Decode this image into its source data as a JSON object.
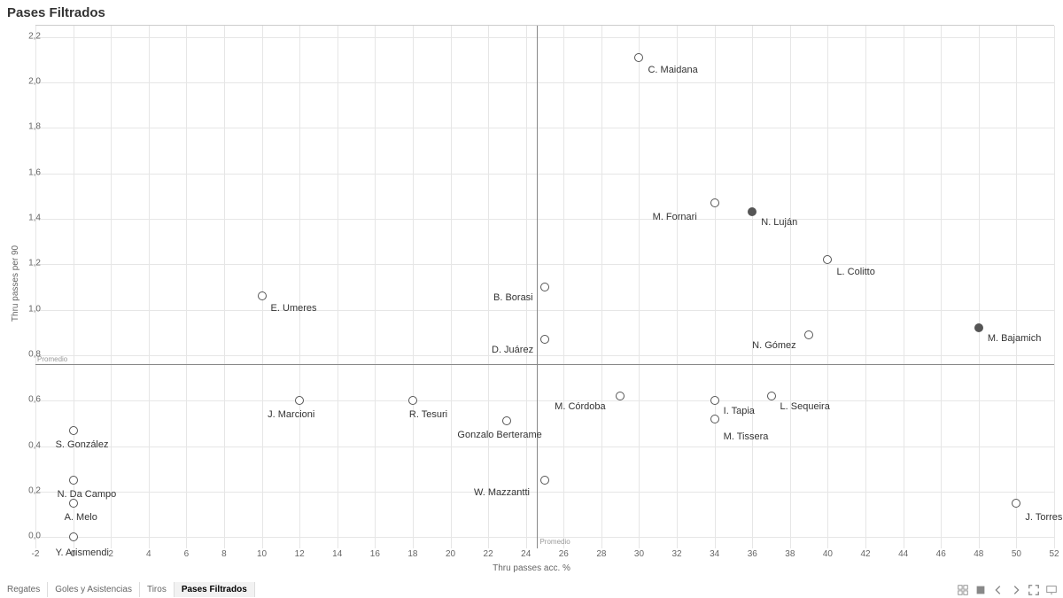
{
  "title": "Pases Filtrados",
  "axis": {
    "xlabel": "Thru passes acc. %",
    "ylabel": "Thru passes per 90"
  },
  "reference": {
    "label": "Promedio",
    "xval": 24.6,
    "yval": 0.76
  },
  "tabs": [
    "Regates",
    "Goles y Asistencias",
    "Tiros",
    "Pases Filtrados"
  ],
  "active_tab": 3,
  "chart_data": {
    "type": "scatter",
    "xlabel": "Thru passes acc. %",
    "ylabel": "Thru passes per 90",
    "xlim": [
      -2,
      52
    ],
    "ylim": [
      -0.05,
      2.25
    ],
    "xticks": [
      -2,
      0,
      2,
      4,
      6,
      8,
      10,
      12,
      14,
      16,
      18,
      20,
      22,
      24,
      26,
      28,
      30,
      32,
      34,
      36,
      38,
      40,
      42,
      44,
      46,
      48,
      50,
      52
    ],
    "yticks": [
      0.0,
      0.2,
      0.4,
      0.6,
      0.8,
      1.0,
      1.2,
      1.4,
      1.6,
      1.8,
      2.0,
      2.2
    ],
    "reference_lines": {
      "x": 24.6,
      "y": 0.76,
      "label": "Promedio"
    },
    "points": [
      {
        "name": "C. Maidana",
        "x": 30.0,
        "y": 2.11,
        "filled": false
      },
      {
        "name": "M. Fornari",
        "x": 34.0,
        "y": 1.47,
        "filled": false
      },
      {
        "name": "N. Luján",
        "x": 36.0,
        "y": 1.43,
        "filled": true
      },
      {
        "name": "L. Colitto",
        "x": 40.0,
        "y": 1.22,
        "filled": false
      },
      {
        "name": "B. Borasi",
        "x": 25.0,
        "y": 1.1,
        "filled": false
      },
      {
        "name": "E. Umeres",
        "x": 10.0,
        "y": 1.06,
        "filled": false
      },
      {
        "name": "M. Bajamich",
        "x": 48.0,
        "y": 0.92,
        "filled": true
      },
      {
        "name": "N. Gómez",
        "x": 39.0,
        "y": 0.89,
        "filled": false
      },
      {
        "name": "D. Juárez",
        "x": 25.0,
        "y": 0.87,
        "filled": false
      },
      {
        "name": "M. Córdoba",
        "x": 29.0,
        "y": 0.62,
        "filled": false
      },
      {
        "name": "L. Sequeira",
        "x": 37.0,
        "y": 0.62,
        "filled": false
      },
      {
        "name": "J. Marcioni",
        "x": 12.0,
        "y": 0.6,
        "filled": false
      },
      {
        "name": "R. Tesuri",
        "x": 18.0,
        "y": 0.6,
        "filled": false
      },
      {
        "name": "I. Tapia",
        "x": 34.0,
        "y": 0.6,
        "filled": false
      },
      {
        "name": "M. Tissera",
        "x": 34.0,
        "y": 0.52,
        "filled": false
      },
      {
        "name": "Gonzalo Berterame",
        "x": 23.0,
        "y": 0.51,
        "filled": false
      },
      {
        "name": "S. González",
        "x": 0.0,
        "y": 0.47,
        "filled": false
      },
      {
        "name": "W. Mazzantti",
        "x": 25.0,
        "y": 0.25,
        "filled": false
      },
      {
        "name": "N. Da Campo",
        "x": 0.0,
        "y": 0.25,
        "filled": false
      },
      {
        "name": "A. Melo",
        "x": 0.0,
        "y": 0.15,
        "filled": false
      },
      {
        "name": "J. Torres",
        "x": 50.0,
        "y": 0.15,
        "filled": false
      },
      {
        "name": "Y. Arismendi",
        "x": 0.0,
        "y": 0.0,
        "filled": false
      }
    ],
    "label_offsets": {
      "C. Maidana": {
        "dx": 10,
        "dy": 8
      },
      "M. Fornari": {
        "dx": -70,
        "dy": 10
      },
      "N. Luján": {
        "dx": 10,
        "dy": 6
      },
      "L. Colitto": {
        "dx": 10,
        "dy": 8
      },
      "B. Borasi": {
        "dx": -58,
        "dy": 6
      },
      "E. Umeres": {
        "dx": 10,
        "dy": 8
      },
      "M. Bajamich": {
        "dx": 10,
        "dy": 6
      },
      "N. Gómez": {
        "dx": -64,
        "dy": 6
      },
      "D. Juárez": {
        "dx": -60,
        "dy": 6
      },
      "M. Córdoba": {
        "dx": -74,
        "dy": 6
      },
      "L. Sequeira": {
        "dx": 10,
        "dy": 6
      },
      "J. Marcioni": {
        "dx": -36,
        "dy": 10
      },
      "R. Tesuri": {
        "dx": -4,
        "dy": 10
      },
      "I. Tapia": {
        "dx": 10,
        "dy": 6
      },
      "M. Tissera": {
        "dx": 10,
        "dy": 14
      },
      "Gonzalo Berterame": {
        "dx": -56,
        "dy": 10
      },
      "S. González": {
        "dx": -20,
        "dy": 10
      },
      "W. Mazzantti": {
        "dx": -80,
        "dy": 8
      },
      "N. Da Campo": {
        "dx": -18,
        "dy": 10
      },
      "A. Melo": {
        "dx": -10,
        "dy": 10
      },
      "J. Torres": {
        "dx": 10,
        "dy": 10
      },
      "Y. Arismendi": {
        "dx": -20,
        "dy": 12
      }
    }
  }
}
